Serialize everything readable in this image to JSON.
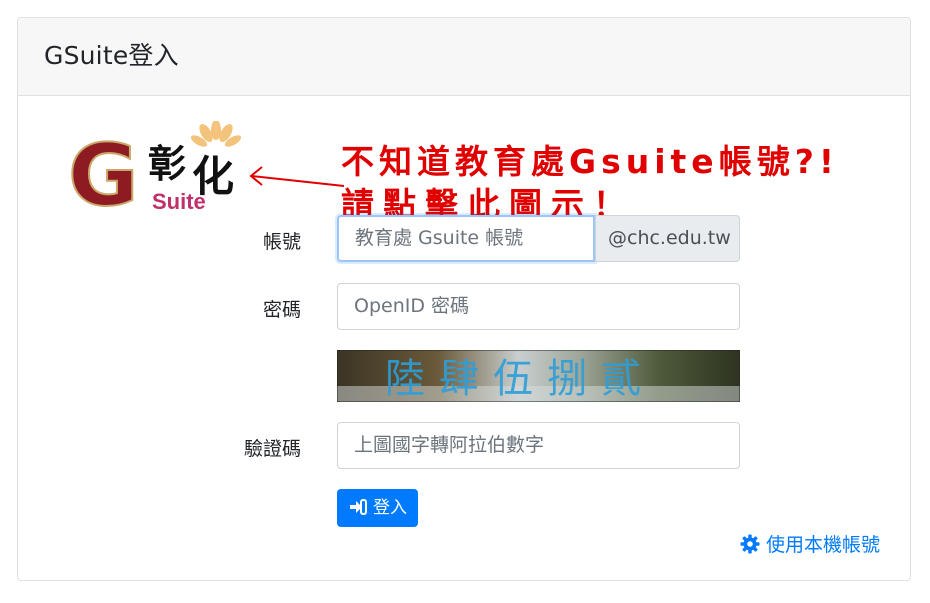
{
  "header": {
    "title": "GSuite登入"
  },
  "logo": {
    "name": "彰化 Suite logo",
    "char1": "彰",
    "char2": "化",
    "suite": "Suite",
    "g": "G"
  },
  "notice": {
    "line1": "不知道教育處Gsuite帳號?!",
    "line2": "請點擊此圖示！"
  },
  "form": {
    "account_label": "帳號",
    "account_placeholder": "教育處 Gsuite 帳號",
    "account_suffix": "@chc.edu.tw",
    "password_label": "密碼",
    "password_placeholder": "OpenID 密碼",
    "captcha_text": "陸肆伍捌貳",
    "captcha_label": "驗證碼",
    "captcha_placeholder": "上圖國字轉阿拉伯數字",
    "login_button": "登入"
  },
  "footer": {
    "local_account_link": "使用本機帳號"
  },
  "colors": {
    "primary": "#007bff",
    "warning_text": "#e00000",
    "header_bg": "#f7f7f7"
  }
}
